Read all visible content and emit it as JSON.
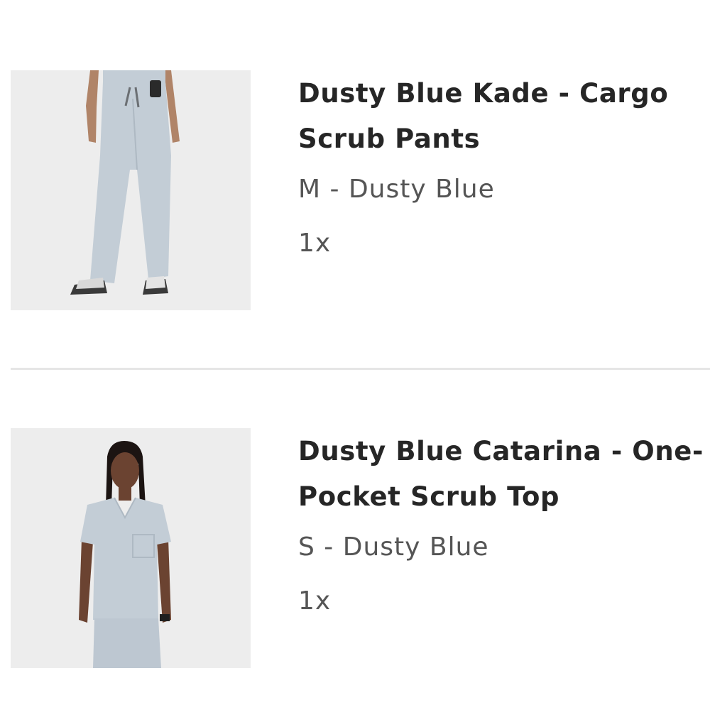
{
  "cart": {
    "items": [
      {
        "title": "Dusty Blue Kade - Cargo Scrub Pants",
        "variant": "M - Dusty Blue",
        "quantity": "1x",
        "image_alt": "model-wearing-cargo-scrub-pants"
      },
      {
        "title": "Dusty Blue Catarina - One-Pocket Scrub Top",
        "variant": "S - Dusty Blue",
        "quantity": "1x",
        "image_alt": "model-wearing-one-pocket-scrub-top"
      }
    ]
  },
  "colors": {
    "scrub_fabric": "#c3cdd6",
    "photo_background": "#ededed",
    "divider": "#e6e6e6",
    "title_text": "#262626",
    "secondary_text": "#555555"
  }
}
